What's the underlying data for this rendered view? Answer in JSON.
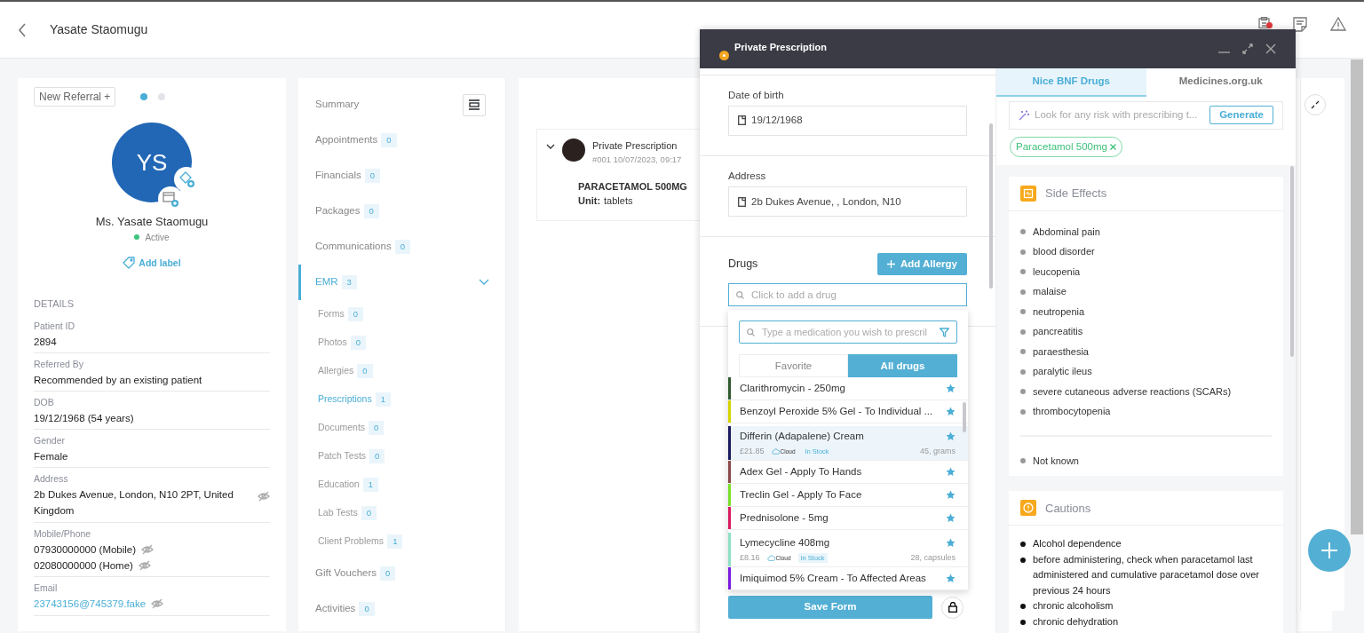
{
  "header": {
    "title": "Yasate Staomugu"
  },
  "patient_card": {
    "referral_button": "New Referral +",
    "pager_dots": [
      {
        "selected": true
      },
      {
        "selected": false
      }
    ],
    "initials": "YS",
    "name": "Ms. Yasate Staomugu",
    "status": {
      "label": "Active",
      "color": "#3cc47c"
    },
    "add_label": "Add label",
    "details_title": "DETAILS",
    "details": [
      {
        "label": "Patient ID",
        "values": [
          {
            "text": "2894",
            "masked": false
          }
        ]
      },
      {
        "label": "Referred By",
        "values": [
          {
            "text": "Recommended by an existing patient",
            "masked": false
          }
        ]
      },
      {
        "label": "DOB",
        "values": [
          {
            "text": "19/12/1968 (54 years)",
            "masked": false
          }
        ]
      },
      {
        "label": "Gender",
        "values": [
          {
            "text": "Female",
            "masked": false
          }
        ]
      },
      {
        "label": "Address",
        "values": [
          {
            "text": "2b Dukes Avenue, London, N10 2PT, United Kingdom",
            "masked": true
          }
        ]
      },
      {
        "label": "Mobile/Phone",
        "values": [
          {
            "text": "07930000000 (Mobile)",
            "masked": true
          },
          {
            "text": "02080000000 (Home)",
            "masked": true
          }
        ]
      },
      {
        "label": "Email",
        "link": true,
        "values": [
          {
            "text": "23743156@745379.fake",
            "masked": true
          }
        ]
      }
    ]
  },
  "nav": {
    "items": [
      {
        "label": "Summary",
        "selected": false
      },
      {
        "label": "Appointments",
        "count": "0",
        "selected": false
      },
      {
        "label": "Financials",
        "count": "0",
        "selected": false
      },
      {
        "label": "Packages",
        "count": "0",
        "selected": false
      },
      {
        "label": "Communications",
        "count": "0",
        "selected": false
      },
      {
        "label": "EMR",
        "count": "3",
        "selected": true,
        "expanded": true,
        "children": [
          {
            "label": "Forms",
            "count": "0",
            "selected": false
          },
          {
            "label": "Photos",
            "count": "0",
            "selected": false
          },
          {
            "label": "Allergies",
            "count": "0",
            "selected": false
          },
          {
            "label": "Prescriptions",
            "count": "1",
            "selected": true
          },
          {
            "label": "Documents",
            "count": "0",
            "selected": false
          },
          {
            "label": "Patch Tests",
            "count": "0",
            "selected": false
          },
          {
            "label": "Education",
            "count": "1",
            "selected": false
          },
          {
            "label": "Lab Tests",
            "count": "0",
            "selected": false
          },
          {
            "label": "Client Problems",
            "count": "1",
            "selected": false
          }
        ]
      },
      {
        "label": "Gift Vouchers",
        "count": "0",
        "selected": false
      },
      {
        "label": "Activities",
        "count": "0",
        "selected": false
      }
    ]
  },
  "record": {
    "title": "Private Prescription",
    "meta": "#001 10/07/2023, 09:17",
    "drug": "PARACETAMOL 500MG",
    "unit_label": "Unit:",
    "unit": "tablets"
  },
  "modal": {
    "title": "Private Prescription",
    "fields": [
      {
        "label": "Date of birth",
        "value": "19/12/1968"
      },
      {
        "label": "Address",
        "value": "2b Dukes Avenue, , London, N10"
      }
    ],
    "drugs_label": "Drugs",
    "add_allergy": "Add Allergy",
    "drug_placeholder": "Click to add a drug",
    "dropdown": {
      "search_placeholder": "Type a medication you wish to prescril",
      "tabs": [
        {
          "label": "Favorite",
          "selected": false
        },
        {
          "label": "All drugs",
          "selected": true
        }
      ],
      "items": [
        {
          "name": "Clarithromycin - 250mg",
          "color": "#2e5a2e",
          "favorite": true,
          "selected": false
        },
        {
          "name": "Benzoyl Peroxide 5% Gel - To Individual ...",
          "color": "#d4d400",
          "favorite": true,
          "selected": false
        },
        {
          "name": "Differin (Adapalene) Cream",
          "color": "#1a1a5e",
          "favorite": true,
          "selected": true,
          "price": "£21.85",
          "supplier": "Cloud",
          "stock": "In Stock",
          "pack": "45, grams"
        },
        {
          "name": "Adex Gel - Apply To Hands",
          "color": "#8a4a4a",
          "favorite": true,
          "selected": false
        },
        {
          "name": "Treclin Gel - Apply To Face",
          "color": "#7ae02a",
          "favorite": true,
          "selected": false
        },
        {
          "name": "Prednisolone - 5mg",
          "color": "#d81b60",
          "favorite": true,
          "selected": false
        },
        {
          "name": "Lymecycline 408mg",
          "color": "#8fe0c4",
          "favorite": true,
          "selected": false,
          "price": "£8.16",
          "supplier": "Cloud",
          "stock": "In Stock",
          "pack": "28, capsules"
        },
        {
          "name": "Imiquimod 5% Cream - To Affected Areas",
          "color": "#7a1ae0",
          "favorite": true,
          "selected": false
        }
      ]
    },
    "save_button": "Save Form",
    "info_tabs": [
      {
        "label": "Nice BNF Drugs",
        "selected": true
      },
      {
        "label": "Medicines.org.uk",
        "selected": false
      }
    ],
    "ai_placeholder": "Look for any risk with prescribing t...",
    "generate_button": "Generate",
    "chips": [
      "Paracetamol 500mg"
    ],
    "cards": [
      {
        "kind": "side_effects",
        "title": "Side Effects",
        "groups": [
          [
            "Abdominal pain",
            "blood disorder",
            "leucopenia",
            "malaise",
            "neutropenia",
            "pancreatitis",
            "paraesthesia",
            "paralytic ileus",
            "severe cutaneous adverse reactions (SCARs)",
            "thrombocytopenia"
          ],
          [
            "Not known"
          ]
        ]
      },
      {
        "kind": "cautions",
        "title": "Cautions",
        "groups": [
          [
            "Alcohol dependence",
            "before administering, check when paracetamol last administered and cumulative paracetamol dose over previous 24 hours",
            "chronic alcoholism",
            "chronic dehydration"
          ]
        ]
      }
    ]
  }
}
